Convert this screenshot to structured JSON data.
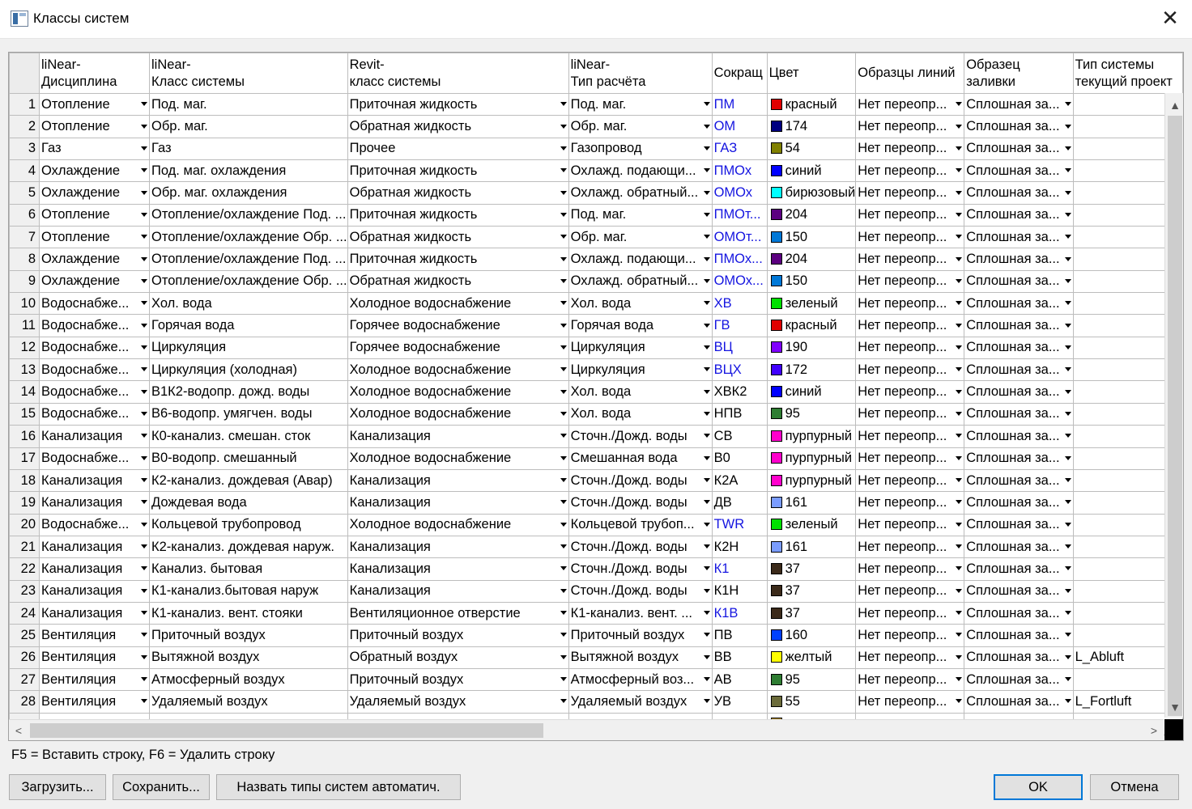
{
  "window": {
    "title": "Классы систем",
    "close_glyph": "✕"
  },
  "columns": [
    "liNear-\nДисциплина",
    "liNear-\nКласс системы",
    "Revit-\nкласс системы",
    "liNear-\nТип расчёта",
    "Сокращ",
    "Цвет",
    "Образцы линий",
    "Образец заливки",
    "Тип системы\nтекущий проект"
  ],
  "rows": [
    {
      "n": "1",
      "disc": "Отопление",
      "cls": "Под. маг.",
      "revit": "Приточная жидкость",
      "calc": "Под. маг.",
      "abbr": "ПМ",
      "abbr_blue": true,
      "color": "#e00000",
      "cname": "красный",
      "line": "Нет переопр...",
      "fill": "Сплошная за...",
      "sys": ""
    },
    {
      "n": "2",
      "disc": "Отопление",
      "cls": "Обр. маг.",
      "revit": "Обратная жидкость",
      "calc": "Обр. маг.",
      "abbr": "ОМ",
      "abbr_blue": true,
      "color": "#000080",
      "cname": "174",
      "line": "Нет переопр...",
      "fill": "Сплошная за...",
      "sys": ""
    },
    {
      "n": "3",
      "disc": "Газ",
      "cls": "Газ",
      "revit": "Прочее",
      "calc": "Газопровод",
      "abbr": "ГАЗ",
      "abbr_blue": true,
      "color": "#808000",
      "cname": "54",
      "line": "Нет переопр...",
      "fill": "Сплошная за...",
      "sys": ""
    },
    {
      "n": "4",
      "disc": "Охлаждение",
      "cls": "Под. маг. охлаждения",
      "revit": "Приточная жидкость",
      "calc": "Охлажд. подающи...",
      "abbr": "ПМОх",
      "abbr_blue": true,
      "color": "#0000ff",
      "cname": "синий",
      "line": "Нет переопр...",
      "fill": "Сплошная за...",
      "sys": ""
    },
    {
      "n": "5",
      "disc": "Охлаждение",
      "cls": "Обр. маг. охлаждения",
      "revit": "Обратная жидкость",
      "calc": "Охлажд. обратный...",
      "abbr": "ОМОх",
      "abbr_blue": true,
      "color": "#00ffff",
      "cname": "бирюзовый",
      "line": "Нет переопр...",
      "fill": "Сплошная за...",
      "sys": ""
    },
    {
      "n": "6",
      "disc": "Отопление",
      "cls": "Отопление/охлаждение Под. ...",
      "revit": "Приточная жидкость",
      "calc": "Под. маг.",
      "abbr": "ПМОт...",
      "abbr_blue": true,
      "color": "#5c0080",
      "cname": "204",
      "line": "Нет переопр...",
      "fill": "Сплошная за...",
      "sys": ""
    },
    {
      "n": "7",
      "disc": "Отопление",
      "cls": "Отопление/охлаждение Обр. ...",
      "revit": "Обратная жидкость",
      "calc": "Обр. маг.",
      "abbr": "ОМОт...",
      "abbr_blue": true,
      "color": "#0078d7",
      "cname": "150",
      "line": "Нет переопр...",
      "fill": "Сплошная за...",
      "sys": ""
    },
    {
      "n": "8",
      "disc": "Охлаждение",
      "cls": "Отопление/охлаждение Под. ...",
      "revit": "Приточная жидкость",
      "calc": "Охлажд. подающи...",
      "abbr": "ПМОх...",
      "abbr_blue": true,
      "color": "#5c0080",
      "cname": "204",
      "line": "Нет переопр...",
      "fill": "Сплошная за...",
      "sys": ""
    },
    {
      "n": "9",
      "disc": "Охлаждение",
      "cls": "Отопление/охлаждение Обр. ...",
      "revit": "Обратная жидкость",
      "calc": "Охлажд. обратный...",
      "abbr": "ОМОх...",
      "abbr_blue": true,
      "color": "#0078d7",
      "cname": "150",
      "line": "Нет переопр...",
      "fill": "Сплошная за...",
      "sys": ""
    },
    {
      "n": "10",
      "disc": "Водоснабже...",
      "cls": "Хол. вода",
      "revit": "Холодное водоснабжение",
      "calc": "Хол. вода",
      "abbr": "ХВ",
      "abbr_blue": true,
      "color": "#00e000",
      "cname": "зеленый",
      "line": "Нет переопр...",
      "fill": "Сплошная за...",
      "sys": ""
    },
    {
      "n": "11",
      "disc": "Водоснабже...",
      "cls": "Горячая вода",
      "revit": "Горячее водоснабжение",
      "calc": "Горячая вода",
      "abbr": "ГВ",
      "abbr_blue": true,
      "color": "#e00000",
      "cname": "красный",
      "line": "Нет переопр...",
      "fill": "Сплошная за...",
      "sys": ""
    },
    {
      "n": "12",
      "disc": "Водоснабже...",
      "cls": "Циркуляция",
      "revit": "Горячее водоснабжение",
      "calc": "Циркуляция",
      "abbr": "ВЦ",
      "abbr_blue": true,
      "color": "#8000ff",
      "cname": "190",
      "line": "Нет переопр...",
      "fill": "Сплошная за...",
      "sys": ""
    },
    {
      "n": "13",
      "disc": "Водоснабже...",
      "cls": "Циркуляция (холодная)",
      "revit": "Холодное водоснабжение",
      "calc": "Циркуляция",
      "abbr": "ВЦХ",
      "abbr_blue": true,
      "color": "#4000ff",
      "cname": "172",
      "line": "Нет переопр...",
      "fill": "Сплошная за...",
      "sys": ""
    },
    {
      "n": "14",
      "disc": "Водоснабже...",
      "cls": "В1К2-водопр. дожд. воды",
      "revit": "Холодное водоснабжение",
      "calc": "Хол. вода",
      "abbr": "ХВК2",
      "abbr_blue": false,
      "color": "#0000ff",
      "cname": "синий",
      "line": "Нет переопр...",
      "fill": "Сплошная за...",
      "sys": ""
    },
    {
      "n": "15",
      "disc": "Водоснабже...",
      "cls": "В6-водопр. умягчен. воды",
      "revit": "Холодное водоснабжение",
      "calc": "Хол. вода",
      "abbr": "НПВ",
      "abbr_blue": false,
      "color": "#2e7d32",
      "cname": "95",
      "line": "Нет переопр...",
      "fill": "Сплошная за...",
      "sys": ""
    },
    {
      "n": "16",
      "disc": "Канализация",
      "cls": "К0-канализ. смешан. сток",
      "revit": "Канализация",
      "calc": "Сточн./Дожд. воды",
      "abbr": "СВ",
      "abbr_blue": false,
      "color": "#ff00cc",
      "cname": "пурпурный",
      "line": "Нет переопр...",
      "fill": "Сплошная за...",
      "sys": ""
    },
    {
      "n": "17",
      "disc": "Водоснабже...",
      "cls": "В0-водопр. смешанный",
      "revit": "Холодное водоснабжение",
      "calc": "Смешанная вода",
      "abbr": "В0",
      "abbr_blue": false,
      "color": "#ff00cc",
      "cname": "пурпурный",
      "line": "Нет переопр...",
      "fill": "Сплошная за...",
      "sys": ""
    },
    {
      "n": "18",
      "disc": "Канализация",
      "cls": "К2-канализ. дождевая (Авар)",
      "revit": "Канализация",
      "calc": "Сточн./Дожд. воды",
      "abbr": "К2А",
      "abbr_blue": false,
      "color": "#ff00cc",
      "cname": "пурпурный",
      "line": "Нет переопр...",
      "fill": "Сплошная за...",
      "sys": ""
    },
    {
      "n": "19",
      "disc": "Канализация",
      "cls": "Дождевая вода",
      "revit": "Канализация",
      "calc": "Сточн./Дожд. воды",
      "abbr": "ДВ",
      "abbr_blue": false,
      "color": "#7a9cff",
      "cname": "161",
      "line": "Нет переопр...",
      "fill": "Сплошная за...",
      "sys": ""
    },
    {
      "n": "20",
      "disc": "Водоснабже...",
      "cls": "Кольцевой трубопровод",
      "revit": "Холодное водоснабжение",
      "calc": "Кольцевой трубоп...",
      "abbr": "TWR",
      "abbr_blue": true,
      "color": "#00e000",
      "cname": "зеленый",
      "line": "Нет переопр...",
      "fill": "Сплошная за...",
      "sys": ""
    },
    {
      "n": "21",
      "disc": "Канализация",
      "cls": "К2-канализ. дождевая наруж.",
      "revit": "Канализация",
      "calc": "Сточн./Дожд. воды",
      "abbr": "К2Н",
      "abbr_blue": false,
      "color": "#7a9cff",
      "cname": "161",
      "line": "Нет переопр...",
      "fill": "Сплошная за...",
      "sys": ""
    },
    {
      "n": "22",
      "disc": "Канализация",
      "cls": "Канализ. бытовая",
      "revit": "Канализация",
      "calc": "Сточн./Дожд. воды",
      "abbr": "К1",
      "abbr_blue": true,
      "color": "#3b2a1a",
      "cname": "37",
      "line": "Нет переопр...",
      "fill": "Сплошная за...",
      "sys": ""
    },
    {
      "n": "23",
      "disc": "Канализация",
      "cls": "К1-канализ.бытовая наруж",
      "revit": "Канализация",
      "calc": "Сточн./Дожд. воды",
      "abbr": "К1Н",
      "abbr_blue": false,
      "color": "#3b2a1a",
      "cname": "37",
      "line": "Нет переопр...",
      "fill": "Сплошная за...",
      "sys": ""
    },
    {
      "n": "24",
      "disc": "Канализация",
      "cls": "К1-канализ. вент. стояки",
      "revit": "Вентиляционное отверстие",
      "calc": "К1-канализ. вент. ...",
      "abbr": "К1В",
      "abbr_blue": true,
      "color": "#3b2a1a",
      "cname": "37",
      "line": "Нет переопр...",
      "fill": "Сплошная за...",
      "sys": ""
    },
    {
      "n": "25",
      "disc": "Вентиляция",
      "cls": "Приточный воздух",
      "revit": "Приточный воздух",
      "calc": "Приточный воздух",
      "abbr": "ПВ",
      "abbr_blue": false,
      "color": "#0040ff",
      "cname": "160",
      "line": "Нет переопр...",
      "fill": "Сплошная за...",
      "sys": ""
    },
    {
      "n": "26",
      "disc": "Вентиляция",
      "cls": "Вытяжной воздух",
      "revit": "Обратный воздух",
      "calc": "Вытяжной воздух",
      "abbr": "ВВ",
      "abbr_blue": false,
      "color": "#ffff00",
      "cname": "желтый",
      "line": "Нет переопр...",
      "fill": "Сплошная за...",
      "sys": "L_Abluft"
    },
    {
      "n": "27",
      "disc": "Вентиляция",
      "cls": "Атмосферный  воздух",
      "revit": "Приточный воздух",
      "calc": "Атмосферный воз...",
      "abbr": "АВ",
      "abbr_blue": false,
      "color": "#2e7d32",
      "cname": "95",
      "line": "Нет переопр...",
      "fill": "Сплошная за...",
      "sys": ""
    },
    {
      "n": "28",
      "disc": "Вентиляция",
      "cls": "Удаляемый воздух",
      "revit": "Удаляемый воздух",
      "calc": "Удаляемый воздух",
      "abbr": "УВ",
      "abbr_blue": false,
      "color": "#6b6b3a",
      "cname": "55",
      "line": "Нет переопр...",
      "fill": "Сплошная за...",
      "sys": "L_Fortluft"
    },
    {
      "n": "",
      "disc": "",
      "cls": "",
      "revit": "",
      "calc": "",
      "abbr": "",
      "abbr_blue": false,
      "color": "#b08a2a",
      "cname": "",
      "line": "",
      "fill": "",
      "sys": ""
    }
  ],
  "hint": "F5 = Вставить строку, F6 = Удалить строку",
  "buttons": {
    "load": "Загрузить...",
    "save": "Сохранить...",
    "autoname": "Назвать типы систем автоматич.",
    "ok": "OK",
    "cancel": "Отмена"
  },
  "scroll_glyphs": {
    "up": "▲",
    "down": "▼",
    "left": "<",
    "right": ">"
  }
}
